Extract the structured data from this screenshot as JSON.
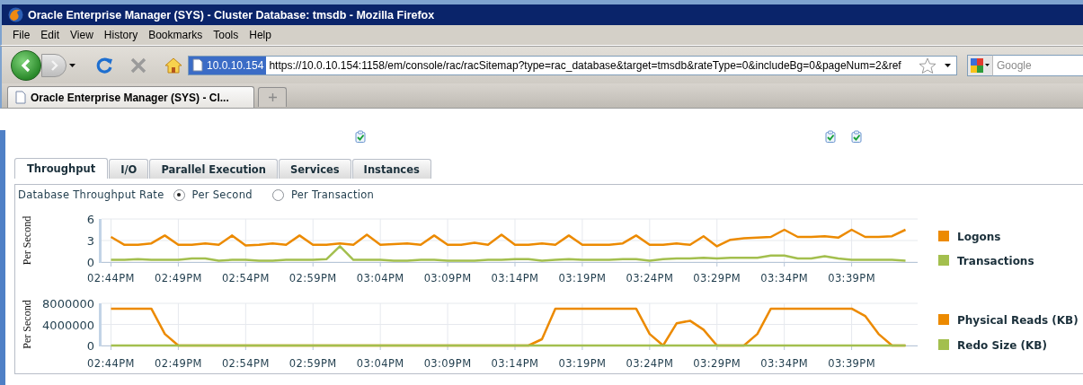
{
  "window": {
    "title": "Oracle Enterprise Manager (SYS) - Cluster Database: tmsdb - Mozilla Firefox"
  },
  "menu": [
    "File",
    "Edit",
    "View",
    "History",
    "Bookmarks",
    "Tools",
    "Help"
  ],
  "toolbar": {
    "site_identity": "10.0.10.154",
    "url": "https://10.0.10.154:1158/em/console/rac/racSitemap?type=rac_database&target=tmsdb&rateType=0&includeBg=0&pageNum=2&ref",
    "search": {
      "placeholder": "Google"
    }
  },
  "tabs": [
    {
      "label": "Oracle Enterprise Manager (SYS) - Cl...",
      "selected": true
    }
  ],
  "page": {
    "tabs": [
      {
        "label": "Throughput",
        "selected": true
      },
      {
        "label": "I/O",
        "selected": false
      },
      {
        "label": "Parallel Execution",
        "selected": false
      },
      {
        "label": "Services",
        "selected": false
      },
      {
        "label": "Instances",
        "selected": false
      }
    ],
    "rate": {
      "label": "Database Throughput Rate",
      "options": [
        {
          "label": "Per Second",
          "selected": true
        },
        {
          "label": "Per Transaction",
          "selected": false
        }
      ]
    },
    "charts": [
      {
        "chart_data": {
          "type": "line",
          "ylabel": "Per Second",
          "categories": [
            "02:44PM",
            null,
            null,
            null,
            null,
            "02:49PM",
            null,
            null,
            null,
            null,
            "02:54PM",
            null,
            null,
            null,
            null,
            "02:59PM",
            null,
            null,
            null,
            null,
            "03:04PM",
            null,
            null,
            null,
            null,
            "03:09PM",
            null,
            null,
            null,
            null,
            "03:14PM",
            null,
            null,
            null,
            null,
            "03:19PM",
            null,
            null,
            null,
            null,
            "03:24PM",
            null,
            null,
            null,
            null,
            "03:29PM",
            null,
            null,
            null,
            null,
            "03:34PM",
            null,
            null,
            null,
            null,
            "03:39PM",
            null,
            null,
            null,
            null
          ],
          "ylim": [
            0,
            6
          ],
          "yticks": [
            0,
            3,
            6
          ],
          "grid": true,
          "legend": "right",
          "series": [
            {
              "name": "Logons",
              "color": "#ec8a00",
              "values": [
                3.5,
                2.4,
                2.4,
                2.6,
                3.7,
                2.4,
                2.4,
                2.6,
                2.4,
                3.7,
                2.3,
                2.4,
                2.6,
                2.4,
                3.7,
                2.4,
                2.4,
                2.6,
                2.4,
                3.8,
                2.4,
                2.5,
                2.6,
                2.4,
                3.7,
                2.4,
                2.4,
                2.7,
                2.4,
                3.8,
                2.4,
                2.4,
                2.6,
                2.4,
                3.7,
                2.4,
                2.4,
                2.4,
                2.6,
                3.7,
                2.4,
                2.4,
                2.6,
                2.4,
                3.6,
                2.2,
                3.1,
                3.3,
                3.4,
                3.5,
                4.5,
                3.5,
                3.5,
                3.6,
                3.4,
                4.5,
                3.5,
                3.5,
                3.6,
                4.5
              ]
            },
            {
              "name": "Transactions",
              "color": "#a3bf4e",
              "values": [
                0.3,
                0.3,
                0.4,
                0.3,
                0.3,
                0.3,
                0.5,
                0.5,
                0.2,
                0.3,
                0.3,
                0.2,
                0.2,
                0.3,
                0.3,
                0.3,
                0.4,
                2.2,
                0.3,
                0.3,
                0.3,
                0.2,
                0.2,
                0.3,
                0.3,
                0.2,
                0.2,
                0.2,
                0.3,
                0.3,
                0.4,
                0.4,
                0.2,
                0.3,
                0.4,
                0.3,
                0.3,
                0.3,
                0.4,
                0.4,
                0.2,
                0.4,
                0.5,
                0.5,
                0.6,
                0.5,
                0.6,
                0.6,
                0.6,
                0.9,
                0.9,
                0.5,
                0.5,
                0.8,
                0.5,
                0.3,
                0.3,
                0.3,
                0.3,
                0.2
              ]
            }
          ]
        }
      },
      {
        "chart_data": {
          "type": "line",
          "ylabel": "Per Second",
          "categories": [
            "02:44PM",
            null,
            null,
            null,
            null,
            "02:49PM",
            null,
            null,
            null,
            null,
            "02:54PM",
            null,
            null,
            null,
            null,
            "02:59PM",
            null,
            null,
            null,
            null,
            "03:04PM",
            null,
            null,
            null,
            null,
            "03:09PM",
            null,
            null,
            null,
            null,
            "03:14PM",
            null,
            null,
            null,
            null,
            "03:19PM",
            null,
            null,
            null,
            null,
            "03:24PM",
            null,
            null,
            null,
            null,
            "03:29PM",
            null,
            null,
            null,
            null,
            "03:34PM",
            null,
            null,
            null,
            null,
            "03:39PM",
            null,
            null,
            null,
            null
          ],
          "ylim": [
            0,
            8000000
          ],
          "yticks": [
            0,
            4000000,
            8000000
          ],
          "grid": true,
          "legend": "right",
          "series": [
            {
              "name": "Physical Reads (KB)",
              "color": "#ec8a00",
              "values": [
                7000000,
                7000000,
                7000000,
                7000000,
                2200000,
                0,
                0,
                0,
                0,
                0,
                0,
                0,
                0,
                0,
                0,
                0,
                0,
                0,
                0,
                0,
                0,
                0,
                0,
                0,
                0,
                0,
                0,
                0,
                0,
                0,
                0,
                0,
                1200000,
                7000000,
                7000000,
                7000000,
                7000000,
                7000000,
                7000000,
                7000000,
                2200000,
                0,
                4200000,
                4700000,
                3000000,
                0,
                0,
                0,
                2200000,
                7000000,
                7000000,
                7000000,
                7000000,
                7000000,
                7000000,
                7000000,
                5600000,
                2200000,
                0,
                0
              ]
            },
            {
              "name": "Redo Size (KB)",
              "color": "#a3bf4e",
              "values": [
                0,
                0,
                0,
                0,
                0,
                0,
                0,
                0,
                0,
                0,
                0,
                0,
                0,
                0,
                0,
                0,
                0,
                0,
                0,
                0,
                0,
                0,
                0,
                0,
                0,
                0,
                0,
                0,
                0,
                0,
                0,
                0,
                0,
                0,
                0,
                0,
                0,
                0,
                0,
                0,
                0,
                0,
                0,
                0,
                0,
                0,
                0,
                0,
                0,
                0,
                0,
                0,
                0,
                0,
                0,
                0,
                0,
                0,
                0,
                0
              ]
            }
          ]
        }
      }
    ]
  }
}
